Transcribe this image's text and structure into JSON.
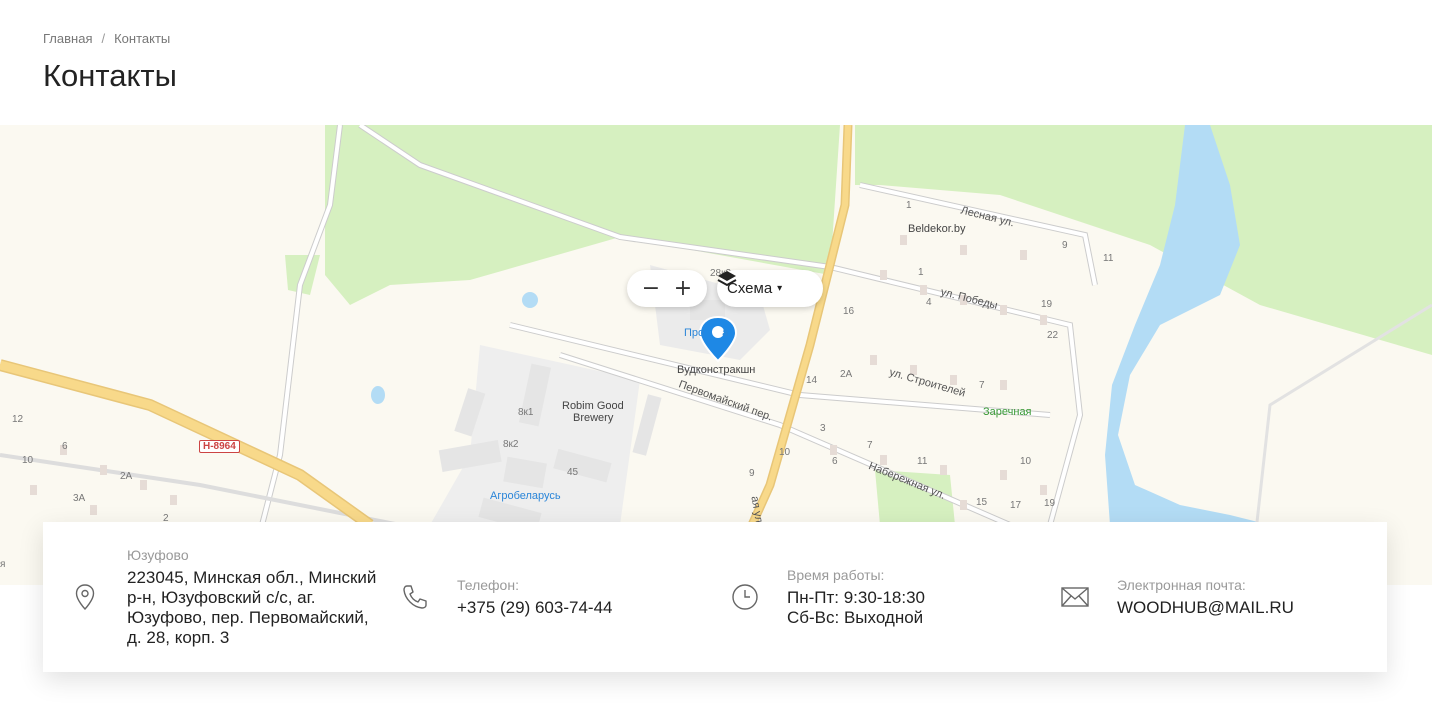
{
  "breadcrumb": {
    "home": "Главная",
    "separator": "/",
    "current": "Контакты"
  },
  "page_title": "Контакты",
  "map": {
    "zoom_out": "−",
    "zoom_in": "+",
    "layer_label": "Схема",
    "layer_caret": "▾",
    "road_badge": "Н-8964",
    "streets": {
      "lesnaya": "Лесная ул.",
      "pobedy": "ул. Победы",
      "stroiteley": "ул. Строителей",
      "pervomaysky": "Первомайский пер.",
      "naberezhnaya": "Набережная ул.",
      "ya_ul": "ая ул."
    },
    "pois": {
      "beldekor": "Beldekor.by",
      "pro": "Про",
      "pro_end": "а",
      "woodconstruction": "Вудконстракшн",
      "robim": "Robim Good",
      "robim2": "Brewery",
      "agrobelarus": "Агробеларусь",
      "zarechnaya": "Заречная"
    },
    "numbers": [
      "1",
      "9",
      "11",
      "1",
      "4",
      "19",
      "22",
      "16",
      "28к2",
      "14",
      "2А",
      "7",
      "3",
      "8к1",
      "8к2",
      "45",
      "10",
      "6",
      "7",
      "11",
      "10",
      "9",
      "15",
      "17",
      "19",
      "12",
      "6",
      "10",
      "2А",
      "3А",
      "2",
      "я"
    ]
  },
  "contacts": {
    "address": {
      "label": "Юзуфово",
      "value": "223045, Минская обл., Минский р-н, Юзуфовский с/с, аг. Юзуфово, пер. Первомайский, д. 28, корп. 3"
    },
    "phone": {
      "label": "Телефон:",
      "value": "+375 (29) 603-74-44"
    },
    "hours": {
      "label": "Время работы:",
      "line1": "Пн-Пт: 9:30-18:30",
      "line2": "Сб-Вс: Выходной"
    },
    "email": {
      "label": "Электронная почта:",
      "value": "WOODHUB@MAIL.RU"
    }
  },
  "colors": {
    "park": "#d6f0c0",
    "water": "#b3dcf5",
    "road_yellow": "#f8d98a",
    "pin": "#1e88e5"
  }
}
